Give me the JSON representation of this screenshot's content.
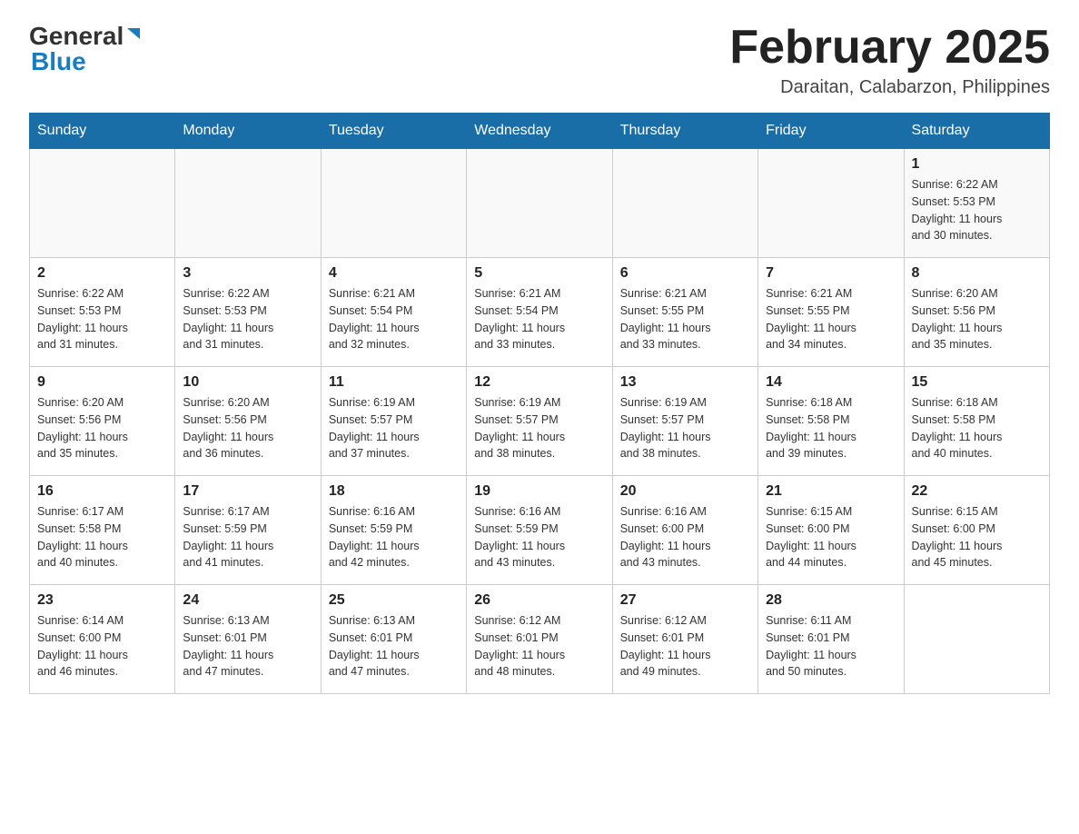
{
  "header": {
    "logo_general": "General",
    "logo_blue": "Blue",
    "month_title": "February 2025",
    "location": "Daraitan, Calabarzon, Philippines"
  },
  "days_of_week": [
    "Sunday",
    "Monday",
    "Tuesday",
    "Wednesday",
    "Thursday",
    "Friday",
    "Saturday"
  ],
  "weeks": [
    [
      {
        "day": "",
        "info": ""
      },
      {
        "day": "",
        "info": ""
      },
      {
        "day": "",
        "info": ""
      },
      {
        "day": "",
        "info": ""
      },
      {
        "day": "",
        "info": ""
      },
      {
        "day": "",
        "info": ""
      },
      {
        "day": "1",
        "info": "Sunrise: 6:22 AM\nSunset: 5:53 PM\nDaylight: 11 hours\nand 30 minutes."
      }
    ],
    [
      {
        "day": "2",
        "info": "Sunrise: 6:22 AM\nSunset: 5:53 PM\nDaylight: 11 hours\nand 31 minutes."
      },
      {
        "day": "3",
        "info": "Sunrise: 6:22 AM\nSunset: 5:53 PM\nDaylight: 11 hours\nand 31 minutes."
      },
      {
        "day": "4",
        "info": "Sunrise: 6:21 AM\nSunset: 5:54 PM\nDaylight: 11 hours\nand 32 minutes."
      },
      {
        "day": "5",
        "info": "Sunrise: 6:21 AM\nSunset: 5:54 PM\nDaylight: 11 hours\nand 33 minutes."
      },
      {
        "day": "6",
        "info": "Sunrise: 6:21 AM\nSunset: 5:55 PM\nDaylight: 11 hours\nand 33 minutes."
      },
      {
        "day": "7",
        "info": "Sunrise: 6:21 AM\nSunset: 5:55 PM\nDaylight: 11 hours\nand 34 minutes."
      },
      {
        "day": "8",
        "info": "Sunrise: 6:20 AM\nSunset: 5:56 PM\nDaylight: 11 hours\nand 35 minutes."
      }
    ],
    [
      {
        "day": "9",
        "info": "Sunrise: 6:20 AM\nSunset: 5:56 PM\nDaylight: 11 hours\nand 35 minutes."
      },
      {
        "day": "10",
        "info": "Sunrise: 6:20 AM\nSunset: 5:56 PM\nDaylight: 11 hours\nand 36 minutes."
      },
      {
        "day": "11",
        "info": "Sunrise: 6:19 AM\nSunset: 5:57 PM\nDaylight: 11 hours\nand 37 minutes."
      },
      {
        "day": "12",
        "info": "Sunrise: 6:19 AM\nSunset: 5:57 PM\nDaylight: 11 hours\nand 38 minutes."
      },
      {
        "day": "13",
        "info": "Sunrise: 6:19 AM\nSunset: 5:57 PM\nDaylight: 11 hours\nand 38 minutes."
      },
      {
        "day": "14",
        "info": "Sunrise: 6:18 AM\nSunset: 5:58 PM\nDaylight: 11 hours\nand 39 minutes."
      },
      {
        "day": "15",
        "info": "Sunrise: 6:18 AM\nSunset: 5:58 PM\nDaylight: 11 hours\nand 40 minutes."
      }
    ],
    [
      {
        "day": "16",
        "info": "Sunrise: 6:17 AM\nSunset: 5:58 PM\nDaylight: 11 hours\nand 40 minutes."
      },
      {
        "day": "17",
        "info": "Sunrise: 6:17 AM\nSunset: 5:59 PM\nDaylight: 11 hours\nand 41 minutes."
      },
      {
        "day": "18",
        "info": "Sunrise: 6:16 AM\nSunset: 5:59 PM\nDaylight: 11 hours\nand 42 minutes."
      },
      {
        "day": "19",
        "info": "Sunrise: 6:16 AM\nSunset: 5:59 PM\nDaylight: 11 hours\nand 43 minutes."
      },
      {
        "day": "20",
        "info": "Sunrise: 6:16 AM\nSunset: 6:00 PM\nDaylight: 11 hours\nand 43 minutes."
      },
      {
        "day": "21",
        "info": "Sunrise: 6:15 AM\nSunset: 6:00 PM\nDaylight: 11 hours\nand 44 minutes."
      },
      {
        "day": "22",
        "info": "Sunrise: 6:15 AM\nSunset: 6:00 PM\nDaylight: 11 hours\nand 45 minutes."
      }
    ],
    [
      {
        "day": "23",
        "info": "Sunrise: 6:14 AM\nSunset: 6:00 PM\nDaylight: 11 hours\nand 46 minutes."
      },
      {
        "day": "24",
        "info": "Sunrise: 6:13 AM\nSunset: 6:01 PM\nDaylight: 11 hours\nand 47 minutes."
      },
      {
        "day": "25",
        "info": "Sunrise: 6:13 AM\nSunset: 6:01 PM\nDaylight: 11 hours\nand 47 minutes."
      },
      {
        "day": "26",
        "info": "Sunrise: 6:12 AM\nSunset: 6:01 PM\nDaylight: 11 hours\nand 48 minutes."
      },
      {
        "day": "27",
        "info": "Sunrise: 6:12 AM\nSunset: 6:01 PM\nDaylight: 11 hours\nand 49 minutes."
      },
      {
        "day": "28",
        "info": "Sunrise: 6:11 AM\nSunset: 6:01 PM\nDaylight: 11 hours\nand 50 minutes."
      },
      {
        "day": "",
        "info": ""
      }
    ]
  ]
}
